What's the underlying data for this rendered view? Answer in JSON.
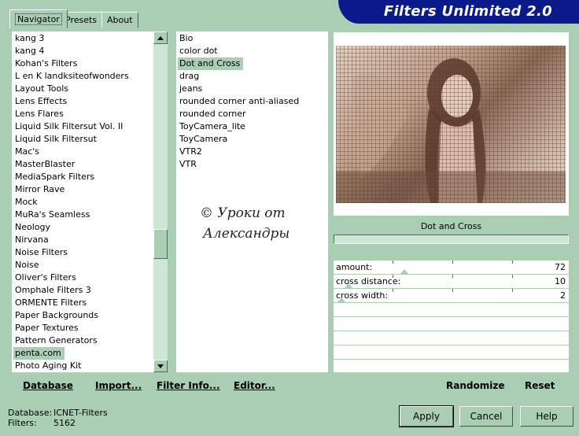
{
  "tabs": [
    "Navigator",
    "Presets",
    "About"
  ],
  "header": {
    "title": "Filters Unlimited 2.0"
  },
  "categories": [
    "kang 3",
    "kang 4",
    "Kohan's Filters",
    "L en K landksiteofwonders",
    "Layout Tools",
    "Lens Effects",
    "Lens Flares",
    "Liquid Silk Filtersut Vol. II",
    "Liquid Silk Filtersut",
    "Mac's",
    "MasterBlaster",
    "MediaSpark Filters",
    "Mirror Rave",
    "Mock",
    "MuRa's Seamless",
    "Neology",
    "Nirvana",
    "Noise Filters",
    "Noise",
    "Oliver's Filters",
    "Omphale Filters 3",
    "ORMENTE Filters",
    "Paper Backgrounds",
    "Paper Textures",
    "Pattern Generators",
    "penta.com",
    "Photo Aging Kit"
  ],
  "selected_category": "penta.com",
  "filters": [
    "Bio",
    "color dot",
    "Dot and Cross",
    "drag",
    "jeans",
    "rounded corner anti-aliased",
    "rounded corner",
    "ToyCamera_lite",
    "ToyCamera",
    "VTR2",
    "VTR"
  ],
  "selected_filter": "Dot and Cross",
  "watermark": [
    "© Уроки от",
    "Александры"
  ],
  "filter_name": "Dot and Cross",
  "params": [
    {
      "label": "amount:",
      "value": "72",
      "level": 72
    },
    {
      "label": "cross distance:",
      "value": "10",
      "level": 10
    },
    {
      "label": "cross width:",
      "value": "2",
      "level": 2
    }
  ],
  "toolbar": {
    "database": "Database",
    "import": "Import...",
    "filter_info": "Filter Info...",
    "editor": "Editor...",
    "randomize": "Randomize",
    "reset": "Reset"
  },
  "status": {
    "database_label": "Database:",
    "database_value": "ICNET-Filters",
    "filters_label": "Filters:",
    "filters_value": "5162"
  },
  "buttons": {
    "apply": "Apply",
    "cancel": "Cancel",
    "help": "Help"
  },
  "colors": {
    "background": "#a9ceb4",
    "header": "#0b1a8a",
    "selection": "#a9ceb4"
  }
}
